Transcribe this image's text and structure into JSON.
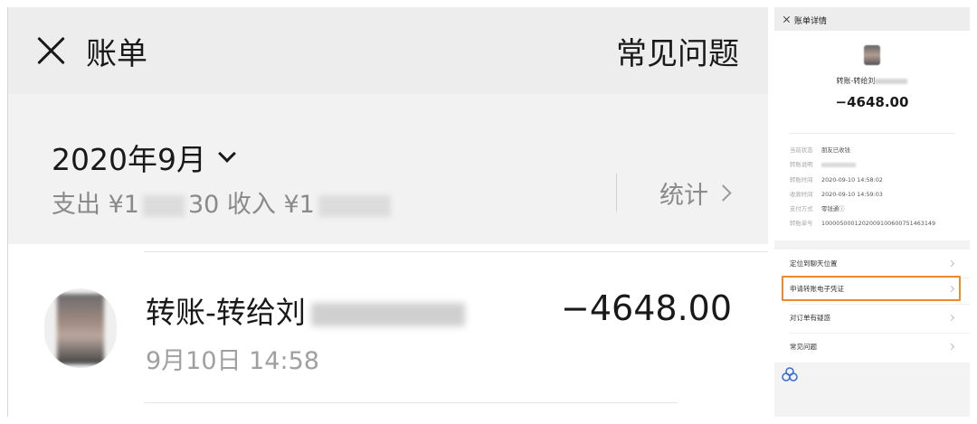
{
  "list_screen": {
    "title": "账单",
    "faq_label": "常见问题",
    "month": "2020年9月",
    "expense_prefix": "支出 ¥1",
    "expense_suffix": "30",
    "income_prefix": "收入 ¥1",
    "stats_label": "统计",
    "bill": {
      "name": "转账-转给刘",
      "time": "9月10日 14:58",
      "amount": "−4648.00"
    }
  },
  "detail_screen": {
    "title": "账单详情",
    "payee": "转账-转给刘",
    "amount": "−4648.00",
    "details": [
      {
        "label": "当前状态",
        "value": "朋友已收钱"
      },
      {
        "label": "转账说明",
        "value": ""
      },
      {
        "label": "转账时间",
        "value": "2020-09-10 14:58:02"
      },
      {
        "label": "收款时间",
        "value": "2020-09-10 14:59:03"
      },
      {
        "label": "支付方式",
        "value": "零钱通ⓘ"
      },
      {
        "label": "转账单号",
        "value": "1000050001202009100600751463149"
      }
    ],
    "actions": [
      {
        "label": "定位到聊天位置"
      },
      {
        "label": "申请转账电子凭证"
      },
      {
        "label": "对订单有疑惑"
      },
      {
        "label": "常见问题"
      }
    ],
    "highlight_color": "#ed8a2f"
  }
}
